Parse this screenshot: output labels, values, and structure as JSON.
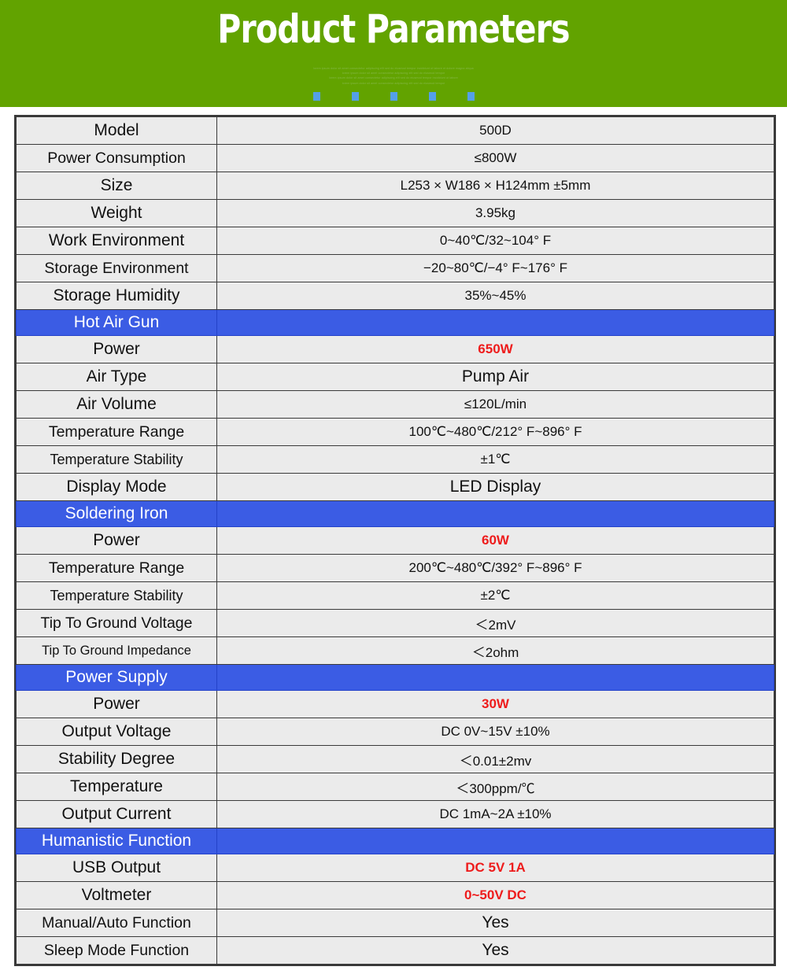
{
  "banner": {
    "title": "Product Parameters",
    "subtext": "lorem ipsum dolor sit amet consectetur adipiscing elit sed do eiusmod tempor incididunt ut labore et dolore magna aliqua\nlorem ipsum dolor sit amet consectetur adipiscing elit sed do eiusmod tempor\nlorem ipsum dolor sit amet consectetur adipiscing elit sed do eiusmod tempor incididunt ut labore\nlorem ipsum dolor sit amet consectetur adipiscing elit sed do eiusmod tempor",
    "dots_count": 5,
    "dot_color": "#54a0e8",
    "background_color": "#62a300"
  },
  "colors": {
    "section_header_bg": "#3b5ce4",
    "section_header_text": "#ffffff",
    "highlight_red": "#ee1c1c",
    "cell_bg": "#ebebeb",
    "border": "#3a3a3a"
  },
  "table": {
    "rows": [
      {
        "type": "data",
        "label": "Model",
        "value": "500D",
        "value_style": "normal",
        "label_size": "normal"
      },
      {
        "type": "data",
        "label": "Power  Consumption",
        "value": "≤800W",
        "value_style": "normal",
        "label_size": "med"
      },
      {
        "type": "data",
        "label": "Size",
        "value": "L253 × W186 × H124mm  ±5mm",
        "value_style": "normal",
        "label_size": "normal"
      },
      {
        "type": "data",
        "label": "Weight",
        "value": "3.95kg",
        "value_style": "normal",
        "label_size": "normal"
      },
      {
        "type": "data",
        "label": "Work Environment",
        "value": "0~40℃/32~104° F",
        "value_style": "normal",
        "label_size": "normal"
      },
      {
        "type": "data",
        "label": "Storage Environment",
        "value": "−20~80℃/−4° F~176° F",
        "value_style": "normal",
        "label_size": "med"
      },
      {
        "type": "data",
        "label": "Storage Humidity",
        "value": "35%~45%",
        "value_style": "normal",
        "label_size": "normal"
      },
      {
        "type": "section",
        "label": "Hot Air Gun",
        "value": "",
        "value_style": "normal",
        "label_size": "normal"
      },
      {
        "type": "data",
        "label": "Power",
        "value": "650W",
        "value_style": "red",
        "label_size": "normal"
      },
      {
        "type": "data",
        "label": "Air Type",
        "value": "Pump Air",
        "value_style": "big",
        "label_size": "normal"
      },
      {
        "type": "data",
        "label": "Air Volume",
        "value": "≤120L/min",
        "value_style": "normal",
        "label_size": "normal"
      },
      {
        "type": "data",
        "label": "Temperature Range",
        "value": "100℃~480℃/212° F~896° F",
        "value_style": "normal",
        "label_size": "med"
      },
      {
        "type": "data",
        "label": "Temperature Stability",
        "value": "±1℃",
        "value_style": "normal",
        "label_size": "small"
      },
      {
        "type": "data",
        "label": "Display Mode",
        "value": "LED Display",
        "value_style": "big",
        "label_size": "normal"
      },
      {
        "type": "section",
        "label": "Soldering Iron",
        "value": "",
        "value_style": "normal",
        "label_size": "normal"
      },
      {
        "type": "data",
        "label": "Power",
        "value": "60W",
        "value_style": "red",
        "label_size": "normal"
      },
      {
        "type": "data",
        "label": "Temperature Range",
        "value": "200℃~480℃/392° F~896° F",
        "value_style": "normal",
        "label_size": "med"
      },
      {
        "type": "data",
        "label": "Temperature Stability",
        "value": "±2℃",
        "value_style": "normal",
        "label_size": "small"
      },
      {
        "type": "data",
        "label": "Tip To Ground Voltage",
        "value": "＜2mV",
        "value_style": "normal",
        "label_size": "med"
      },
      {
        "type": "data",
        "label": "Tip To Ground Impedance",
        "value": "＜2ohm",
        "value_style": "normal",
        "label_size": "xsmall"
      },
      {
        "type": "section",
        "label": "Power Supply",
        "value": "",
        "value_style": "normal",
        "label_size": "normal"
      },
      {
        "type": "data",
        "label": "Power",
        "value": "30W",
        "value_style": "red",
        "label_size": "normal"
      },
      {
        "type": "data",
        "label": "Output  Voltage",
        "value": "DC 0V~15V ±10%",
        "value_style": "normal",
        "label_size": "normal"
      },
      {
        "type": "data",
        "label": "Stability Degree",
        "value": "＜0.01±2mv",
        "value_style": "normal",
        "label_size": "normal"
      },
      {
        "type": "data",
        "label": "Temperature",
        "value": "＜300ppm/℃",
        "value_style": "normal",
        "label_size": "normal"
      },
      {
        "type": "data",
        "label": "Output Current",
        "value": "DC 1mA~2A ±10%",
        "value_style": "normal",
        "label_size": "normal"
      },
      {
        "type": "section",
        "label": "Humanistic Function",
        "value": "",
        "value_style": "normal",
        "label_size": "med"
      },
      {
        "type": "data",
        "label": "USB Output",
        "value": "DC 5V 1A",
        "value_style": "red",
        "label_size": "normal"
      },
      {
        "type": "data",
        "label": "Voltmeter",
        "value": "0~50V DC",
        "value_style": "red",
        "label_size": "normal"
      },
      {
        "type": "data",
        "label": "Manual/Auto Function",
        "value": "Yes",
        "value_style": "big",
        "label_size": "med"
      },
      {
        "type": "data",
        "label": "Sleep Mode Function",
        "value": "Yes",
        "value_style": "big",
        "label_size": "med"
      }
    ]
  }
}
